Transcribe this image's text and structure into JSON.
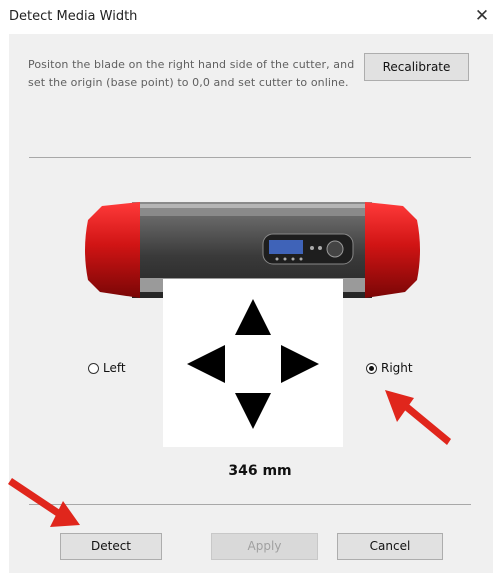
{
  "window": {
    "title": "Detect Media Width",
    "close_glyph": "✕"
  },
  "instructions": "Positon the blade on the right hand side of the cutter, and set the origin (base point) to 0,0 and set cutter to online.",
  "buttons": {
    "recalibrate": "Recalibrate",
    "detect": "Detect",
    "apply": "Apply",
    "cancel": "Cancel"
  },
  "radio": {
    "left_label": "Left",
    "right_label": "Right",
    "selected": "right"
  },
  "media_width": "346 mm",
  "icons": [
    "close-icon",
    "cutter-image",
    "arrow-up-icon",
    "arrow-down-icon",
    "arrow-left-icon",
    "arrow-right-icon"
  ],
  "colors": {
    "panel": "#f0f0f0",
    "cutter_red": "#d01414",
    "annotation_arrow": "#e0261c"
  }
}
